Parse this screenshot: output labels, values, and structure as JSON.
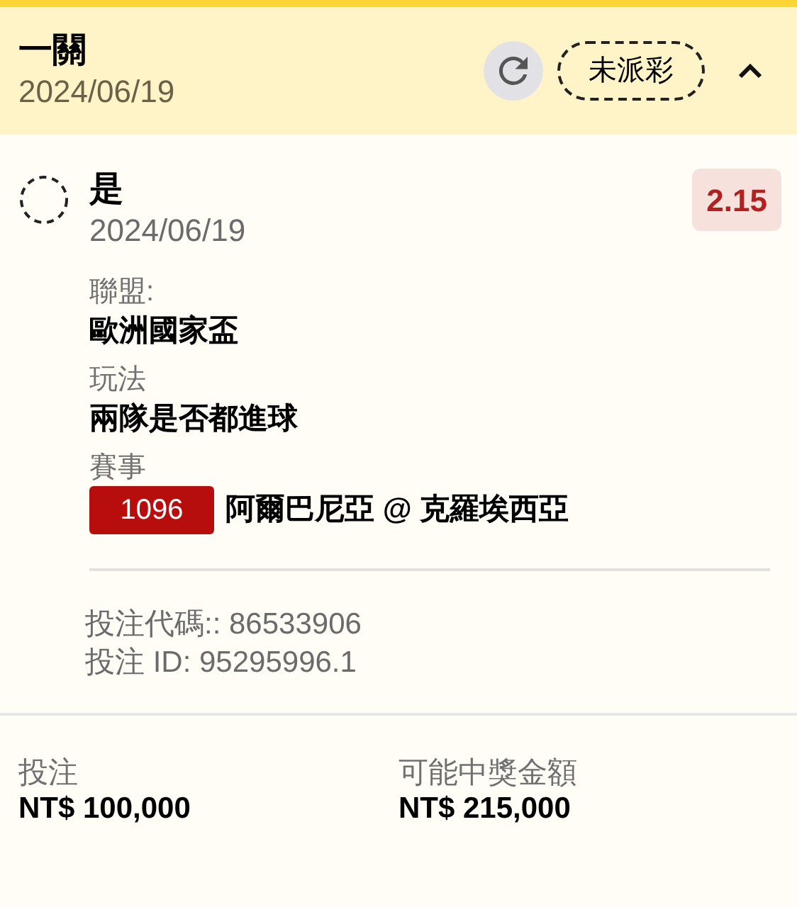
{
  "header": {
    "title": "一關",
    "date": "2024/06/19",
    "status": "未派彩",
    "expanded": true
  },
  "selection": {
    "name": "是",
    "date": "2024/06/19",
    "odds": "2.15"
  },
  "details": [
    {
      "label": "聯盟:",
      "value": "歐洲國家盃"
    },
    {
      "label": "玩法",
      "value": "兩隊是否都進球"
    },
    {
      "label": "賽事",
      "event_no": "1096",
      "value": "阿爾巴尼亞 @ 克羅埃西亞"
    }
  ],
  "codes": [
    "投注代碼:: 86533906",
    "投注 ID: 95295996.1"
  ],
  "totals": [
    {
      "label": "投注",
      "value": "NT$ 100,000"
    },
    {
      "label": "可能中獎金額",
      "value": "NT$ 215,000"
    }
  ]
}
